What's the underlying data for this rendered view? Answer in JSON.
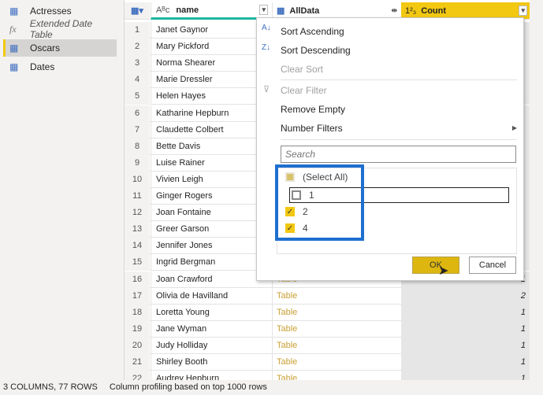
{
  "sidebar": {
    "queries": [
      {
        "label": "Actresses",
        "icon": "table-icon"
      },
      {
        "label": "Extended Date Table",
        "icon": "fx-icon"
      },
      {
        "label": "Oscars",
        "icon": "table-icon",
        "selected": true
      },
      {
        "label": "Dates",
        "icon": "table-icon"
      }
    ]
  },
  "columns": {
    "name": "name",
    "alldata": "AllData",
    "count": "Count",
    "name_type": "Aᴮᴄ",
    "count_type": "1²₃"
  },
  "rows": [
    {
      "n": "1",
      "name": "Janet Gaynor",
      "t": "",
      "c": ""
    },
    {
      "n": "2",
      "name": "Mary Pickford",
      "t": "",
      "c": ""
    },
    {
      "n": "3",
      "name": "Norma Shearer",
      "t": "",
      "c": ""
    },
    {
      "n": "4",
      "name": "Marie Dressler",
      "t": "",
      "c": ""
    },
    {
      "n": "5",
      "name": "Helen Hayes",
      "t": "",
      "c": ""
    },
    {
      "n": "6",
      "name": "Katharine Hepburn",
      "t": "",
      "c": ""
    },
    {
      "n": "7",
      "name": "Claudette Colbert",
      "t": "",
      "c": ""
    },
    {
      "n": "8",
      "name": "Bette Davis",
      "t": "",
      "c": ""
    },
    {
      "n": "9",
      "name": "Luise Rainer",
      "t": "",
      "c": ""
    },
    {
      "n": "10",
      "name": "Vivien Leigh",
      "t": "",
      "c": ""
    },
    {
      "n": "11",
      "name": "Ginger Rogers",
      "t": "",
      "c": ""
    },
    {
      "n": "12",
      "name": "Joan Fontaine",
      "t": "",
      "c": ""
    },
    {
      "n": "13",
      "name": "Greer Garson",
      "t": "",
      "c": ""
    },
    {
      "n": "14",
      "name": "Jennifer Jones",
      "t": "",
      "c": ""
    },
    {
      "n": "15",
      "name": "Ingrid Bergman",
      "t": "",
      "c": ""
    },
    {
      "n": "16",
      "name": "Joan Crawford",
      "t": "Table",
      "c": "1"
    },
    {
      "n": "17",
      "name": "Olivia de Havilland",
      "t": "Table",
      "c": "2"
    },
    {
      "n": "18",
      "name": "Loretta Young",
      "t": "Table",
      "c": "1"
    },
    {
      "n": "19",
      "name": "Jane Wyman",
      "t": "Table",
      "c": "1"
    },
    {
      "n": "20",
      "name": "Judy Holliday",
      "t": "Table",
      "c": "1"
    },
    {
      "n": "21",
      "name": "Shirley Booth",
      "t": "Table",
      "c": "1"
    },
    {
      "n": "22",
      "name": "Audrey Hepburn",
      "t": "Table",
      "c": "1"
    }
  ],
  "menu": {
    "sort_asc": "Sort Ascending",
    "sort_desc": "Sort Descending",
    "clear_sort": "Clear Sort",
    "clear_filter": "Clear Filter",
    "remove_empty": "Remove Empty",
    "number_filters": "Number Filters",
    "search_placeholder": "Search",
    "values": [
      {
        "label": "(Select All)",
        "state": "partial"
      },
      {
        "label": "1",
        "state": "unchecked"
      },
      {
        "label": "2",
        "state": "checked"
      },
      {
        "label": "4",
        "state": "checked"
      }
    ],
    "ok": "OK",
    "cancel": "Cancel"
  },
  "status": {
    "summary": "3 COLUMNS, 77 ROWS",
    "profiling": "Column profiling based on top 1000 rows"
  },
  "colors": {
    "accent": "#f2c811",
    "highlight": "#1e6fd0",
    "table_link": "#c9a135"
  }
}
